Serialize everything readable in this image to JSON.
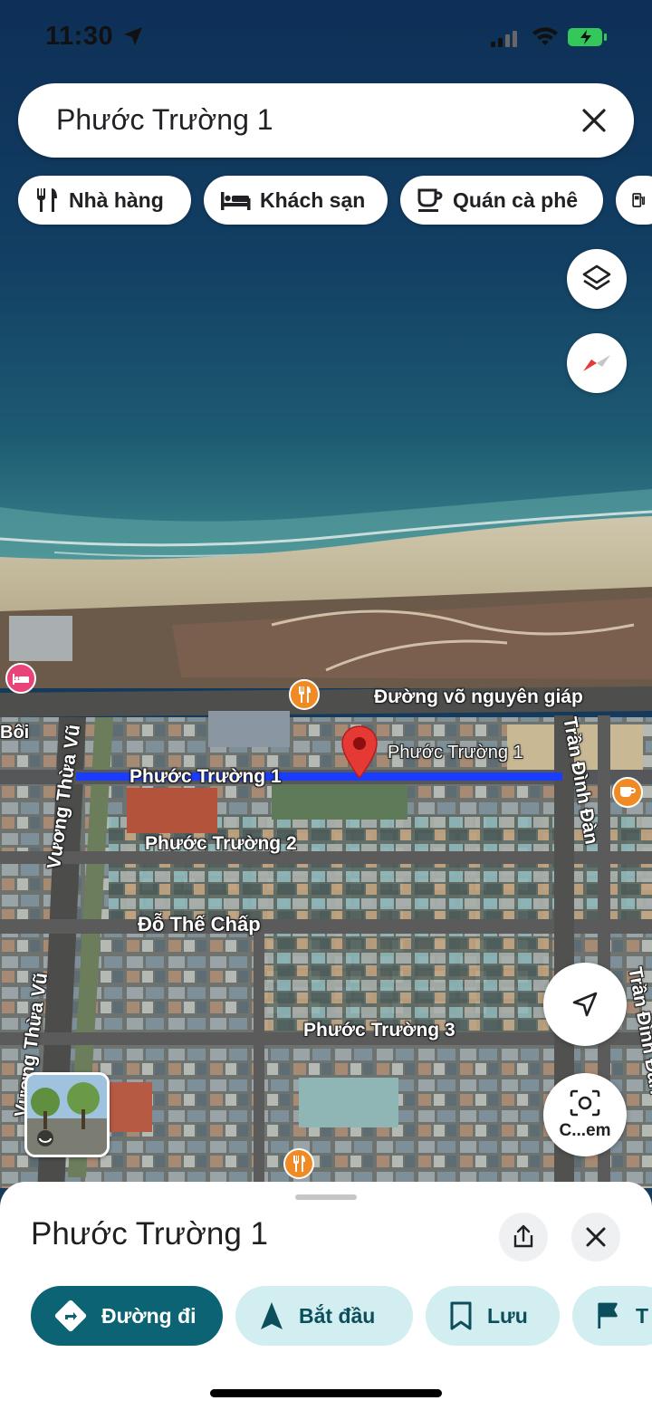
{
  "status_bar": {
    "time": "11:30"
  },
  "search": {
    "query": "Phước Trường 1"
  },
  "chips": [
    {
      "label": "Nhà hàng",
      "icon": "restaurant-icon"
    },
    {
      "label": "Khách sạn",
      "icon": "hotel-icon"
    },
    {
      "label": "Quán cà phê",
      "icon": "coffee-icon"
    },
    {
      "label": "",
      "icon": "gas-station-icon"
    }
  ],
  "map": {
    "labels": {
      "vo_nguyen_giap": "Đường võ nguyên giáp",
      "phuoc_truong_1_pin": "Phước Trường 1",
      "phuoc_truong_1_road": "Phước Trường 1",
      "phuoc_truong_2": "Phước Trường 2",
      "do_the_chap": "Đỗ Thế Chấp",
      "phuoc_truong_3": "Phước Trường 3",
      "vuong_thua_vu_1": "Vương Thừa Vũ",
      "vuong_thua_vu_2": "Vương Thừa Vũ",
      "tran_dinh_dan_1": "Trần Đình Đàn",
      "tran_dinh_dan_2": "Trần Đình Đàn",
      "boi": "Bôi"
    },
    "camera_label": "C...em",
    "highlight_color": "#1a3cff",
    "pin_color": "#e53935"
  },
  "sheet": {
    "title": "Phước Trường 1",
    "actions": [
      {
        "label": "Đường đi",
        "icon": "directions-icon"
      },
      {
        "label": "Bắt đầu",
        "icon": "navigation-icon"
      },
      {
        "label": "Lưu",
        "icon": "bookmark-icon"
      },
      {
        "label": "T",
        "icon": "flag-icon"
      }
    ]
  }
}
